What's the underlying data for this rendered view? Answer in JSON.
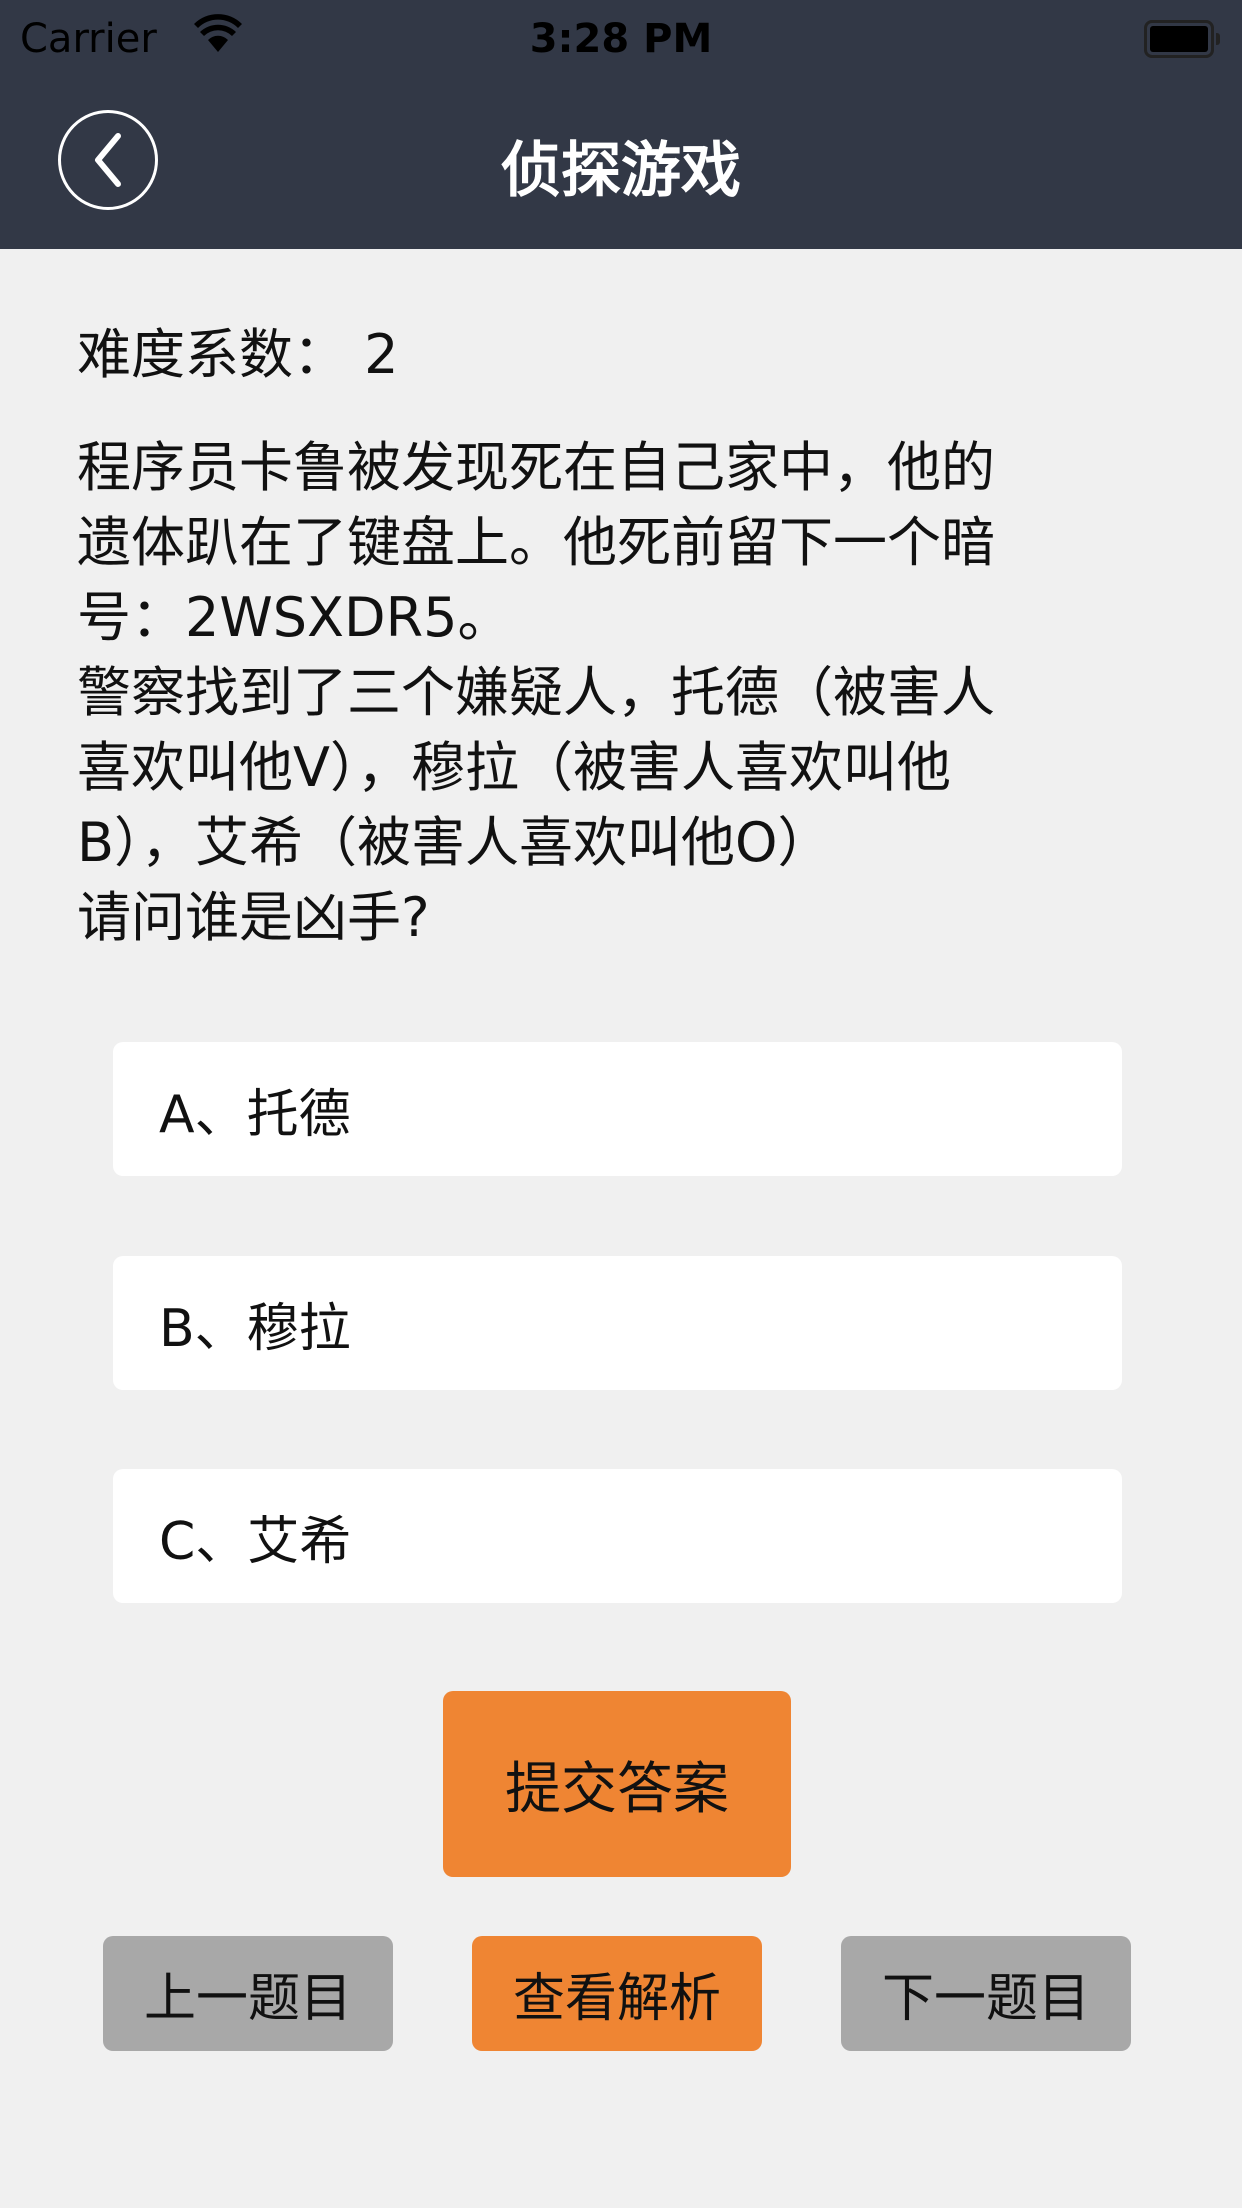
{
  "status_bar": {
    "carrier": "Carrier",
    "time": "3:28 PM",
    "wifi_icon": "wifi-icon",
    "battery_icon": "battery-icon",
    "battery_level": 1.0
  },
  "nav": {
    "title": "侦探游戏",
    "back_icon": "chevron-left-circle-icon"
  },
  "difficulty": "难度系数：  2",
  "question": "程序员卡鲁被发现死在自己家中，他的\n遗体趴在了键盘上。他死前留下一个暗\n号：2WSXDR5。\n警察找到了三个嫌疑人，托德（被害人\n喜欢叫他V），穆拉（被害人喜欢叫他\nB），艾希（被害人喜欢叫他O）\n请问谁是凶手?",
  "options": [
    {
      "label": "A、托德"
    },
    {
      "label": "B、穆拉"
    },
    {
      "label": "C、艾希"
    }
  ],
  "actions": {
    "submit": "提交答案",
    "previous": "上一题目",
    "analysis": "查看解析",
    "next": "下一题目"
  },
  "colors": {
    "nav_bg": "#323846",
    "accent": "#ef8533",
    "secondary": "#a8a8a8",
    "background": "#f0f0f0"
  }
}
